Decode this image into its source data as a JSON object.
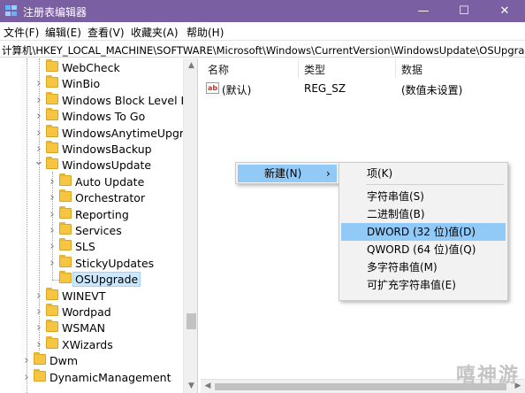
{
  "window": {
    "title": "注册表编辑器",
    "controls": {
      "minimize": "—",
      "maximize": "☐",
      "close": "✕"
    }
  },
  "menubar": [
    "文件(F)",
    "编辑(E)",
    "查看(V)",
    "收藏夹(A)",
    "帮助(H)"
  ],
  "address": "计算机\\HKEY_LOCAL_MACHINE\\SOFTWARE\\Microsoft\\Windows\\CurrentVersion\\WindowsUpdate\\OSUpgrade",
  "tree": {
    "items": [
      {
        "label": "WebCheck",
        "level": 1,
        "expander": "none"
      },
      {
        "label": "WinBio",
        "level": 1,
        "expander": "collapsed"
      },
      {
        "label": "Windows Block Level Back",
        "level": 1,
        "expander": "collapsed"
      },
      {
        "label": "Windows To Go",
        "level": 1,
        "expander": "collapsed"
      },
      {
        "label": "WindowsAnytimeUpgrade",
        "level": 1,
        "expander": "collapsed"
      },
      {
        "label": "WindowsBackup",
        "level": 1,
        "expander": "collapsed"
      },
      {
        "label": "WindowsUpdate",
        "level": 1,
        "expander": "expanded"
      },
      {
        "label": "Auto Update",
        "level": 2,
        "expander": "collapsed"
      },
      {
        "label": "Orchestrator",
        "level": 2,
        "expander": "collapsed"
      },
      {
        "label": "Reporting",
        "level": 2,
        "expander": "collapsed"
      },
      {
        "label": "Services",
        "level": 2,
        "expander": "collapsed"
      },
      {
        "label": "SLS",
        "level": 2,
        "expander": "collapsed"
      },
      {
        "label": "StickyUpdates",
        "level": 2,
        "expander": "collapsed"
      },
      {
        "label": "OSUpgrade",
        "level": 2,
        "expander": "none",
        "selected": true
      },
      {
        "label": "WINEVT",
        "level": 1,
        "expander": "collapsed"
      },
      {
        "label": "Wordpad",
        "level": 1,
        "expander": "collapsed"
      },
      {
        "label": "WSMAN",
        "level": 1,
        "expander": "collapsed"
      },
      {
        "label": "XWizards",
        "level": 1,
        "expander": "collapsed"
      },
      {
        "label": "Dwm",
        "level": 0,
        "expander": "collapsed"
      },
      {
        "label": "DynamicManagement",
        "level": 0,
        "expander": "collapsed"
      }
    ]
  },
  "list": {
    "headers": {
      "name": "名称",
      "type": "类型",
      "data": "数据"
    },
    "rows": [
      {
        "icon": "ab",
        "name": "(默认)",
        "type": "REG_SZ",
        "data": "(数值未设置)"
      }
    ]
  },
  "context_menu": {
    "new_item": "新建(N)",
    "arrow": "›",
    "submenu": {
      "key": "项(K)",
      "string": "字符串值(S)",
      "binary": "二进制值(B)",
      "dword": "DWORD (32 位)值(D)",
      "qword": "QWORD (64 位)值(Q)",
      "multi_string": "多字符串值(M)",
      "expandable_string": "可扩充字符串值(E)"
    }
  },
  "watermark": "嘻神游",
  "colors": {
    "titlebar": "#7a5fa3",
    "highlight": "#91c9f7",
    "folder": "#f6c643",
    "selection": "#cce8ff"
  }
}
